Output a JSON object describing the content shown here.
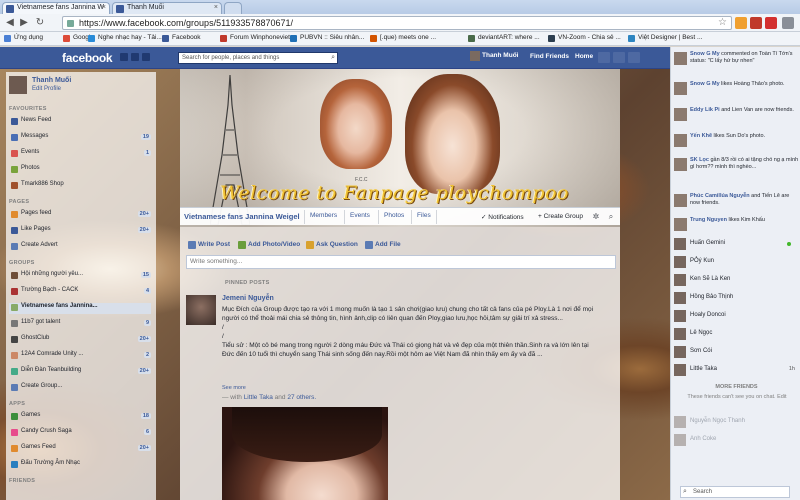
{
  "browser": {
    "tabs": [
      {
        "title": "Vietnamese fans Jannina W",
        "close": "×"
      },
      {
        "title": "Thanh Muối",
        "close": "×"
      }
    ],
    "new_tab": "",
    "url": "https://www.facebook.com/groups/511933578870671/",
    "bookmarks": [
      {
        "label": "Ứng dụng",
        "color": "#4a7fd4"
      },
      {
        "label": "Google",
        "color": "#dd4b39"
      },
      {
        "label": "Nghe nhạc hay - Tải...",
        "color": "#2a8cd8"
      },
      {
        "label": "Facebook",
        "color": "#3b5998"
      },
      {
        "label": "Forum Winphoneviet",
        "color": "#c0392b"
      },
      {
        "label": "PUBVN :: Siêu nhân...",
        "color": "#1f6fb5"
      },
      {
        "label": "[.que) meets one ...",
        "color": "#d35400"
      },
      {
        "label": "deviantART: where ...",
        "color": "#4a6b4a"
      },
      {
        "label": "VN-Zoom - Chia sẻ ...",
        "color": "#2c3e50"
      },
      {
        "label": "Việt Designer | Best ...",
        "color": "#2e86c1"
      }
    ]
  },
  "fb": {
    "logo": "facebook",
    "search_placeholder": "Search for people, places and things",
    "user_name": "Thanh Muối",
    "find_friends": "Find Friends",
    "home": "Home"
  },
  "sidebar": {
    "name": "Thanh Muối",
    "edit_profile": "Edit Profile",
    "favourites_label": "FAVOURITES",
    "favourites": [
      {
        "label": "News Feed",
        "count": "",
        "color": "#3b5998"
      },
      {
        "label": "Messages",
        "count": "19",
        "color": "#4a6eb5"
      },
      {
        "label": "Events",
        "count": "1",
        "color": "#d9534f"
      },
      {
        "label": "Photos",
        "count": "",
        "color": "#7aa33b"
      },
      {
        "label": "Tmark886 Shop",
        "count": "",
        "color": "#a0522d"
      }
    ],
    "pages_label": "PAGES",
    "pages": [
      {
        "label": "Pages feed",
        "count": "20+",
        "color": "#e08a2e"
      },
      {
        "label": "Like Pages",
        "count": "20+",
        "color": "#3b5998"
      },
      {
        "label": "Create Advert",
        "count": "",
        "color": "#5b7bb4"
      }
    ],
    "groups_label": "GROUPS",
    "groups": [
      {
        "label": "Hội những người yêu...",
        "count": "15",
        "color": "#6f4e37",
        "selected": false
      },
      {
        "label": "Trường Bạch - CACK",
        "count": "4",
        "color": "#a33",
        "selected": false
      },
      {
        "label": "Vietnamese fans Jannina...",
        "count": "",
        "color": "#8a6",
        "selected": true
      },
      {
        "label": "11b7 got talent",
        "count": "9",
        "color": "#777",
        "selected": false
      },
      {
        "label": "GhostClub",
        "count": "20+",
        "color": "#444",
        "selected": false
      },
      {
        "label": "12A4 Comrade Unity ...",
        "count": "2",
        "color": "#c86",
        "selected": false
      },
      {
        "label": "Diễn Đàn Teanbuilding",
        "count": "20+",
        "color": "#4a8",
        "selected": false
      },
      {
        "label": "Create Group...",
        "count": "",
        "color": "#5b7bb4",
        "selected": false
      }
    ],
    "apps_label": "APPS",
    "apps": [
      {
        "label": "Games",
        "count": "18",
        "color": "#3b8e3b"
      },
      {
        "label": "Candy Crush Saga",
        "count": "6",
        "color": "#e74c8c"
      },
      {
        "label": "Games Feed",
        "count": "20+",
        "color": "#e08a2e"
      },
      {
        "label": "Đấu Trường Âm Nhạc",
        "count": "",
        "color": "#2a7fbf"
      }
    ],
    "friends_label": "FRIENDS"
  },
  "cover": {
    "title": "Welcome to Fanpage ploychompoo",
    "stamp": "F.C.C"
  },
  "group_nav": {
    "name": "Vietnamese fans Jannina Weigel",
    "tabs": [
      "Members",
      "Events",
      "Photos",
      "Files"
    ],
    "notifications": "Notifications",
    "create_group": "+ Create Group"
  },
  "composer": {
    "tabs": [
      {
        "label": "Write Post",
        "color": "#5b7bb4"
      },
      {
        "label": "Add Photo/Video",
        "color": "#6a9e3b"
      },
      {
        "label": "Ask Question",
        "color": "#d9a12e"
      },
      {
        "label": "Add File",
        "color": "#5b7bb4"
      }
    ],
    "placeholder": "Write something..."
  },
  "feed": {
    "pinned_label": "PINNED POSTS",
    "post": {
      "author": "Jemeni Nguyễn",
      "body": "Mục Đích của Group được tạo ra với 1 mong muốn là tạo 1 sân chơi(giao lưu) chung cho tất cả fans của pé Ploy.Là 1 nơi để mọi người có thể thoải mái chia sẻ thông tin, hình ảnh,clip có liên quan đến Ploy,giao lưu,học hỏi,tâm sự giải trí xả stress...\n/\n/\nTiểu sử : Một cô bé mang trong người 2 dòng máu Đức và Thái có giọng hát và vẻ đẹp của một thiên thần.Sinh ra và lớn lên tại Đức đến 10 tuổi thì chuyển sang Thái sinh sống đến nay.Rồi một hôm ae Việt Nam đã nhìn thấy em ấy và đã ...",
      "see_more": "See more",
      "with_prefix": "— with",
      "with_1": "Little Taka",
      "with_and": "and",
      "with_2": "27 others."
    }
  },
  "ticker": [
    {
      "name": "Snow G My",
      "text": "commented on Toàn Tí Tớn's status: \"C lấy hứ bự nhen\""
    },
    {
      "name": "Snow G My",
      "text": "likes Hoàng Thảo's photo."
    },
    {
      "name": "Eddy Lik Pi",
      "text": "and Lien Van are now friends."
    },
    {
      "name": "Yến Khê",
      "text": "likes Sun Do's photo."
    },
    {
      "name": "SK Lọc",
      "text": "gần 8/3 rồi có ai tặng chó ng ạ mình gì hơm?? mình thì nghèo..."
    },
    {
      "name": "Phúc Camillúa Nguyễn",
      "text": "and Tiến Lê are now friends."
    },
    {
      "name": "Trung Nguyen",
      "text": "likes Kim Khấu"
    }
  ],
  "chat": {
    "online": [
      {
        "name": "Huấn Gemini",
        "status": "online"
      },
      {
        "name": "PỎý Kun",
        "status": ""
      },
      {
        "name": "Ken Sẽ Là Ken",
        "status": ""
      },
      {
        "name": "Hồng Bảo Thịnh",
        "status": ""
      },
      {
        "name": "Hoaly Doncoi",
        "status": ""
      },
      {
        "name": "Lê Ngọc",
        "status": ""
      },
      {
        "name": "Sơn Cói",
        "status": ""
      },
      {
        "name": "Little Taka",
        "status": "1h"
      }
    ],
    "more_friends_label": "MORE FRIENDS",
    "more_note": "These friends can't see you on chat. Edit",
    "offline": [
      "Nguyễn Ngọc Thanh",
      "Anh Coke"
    ],
    "search": "Search"
  }
}
